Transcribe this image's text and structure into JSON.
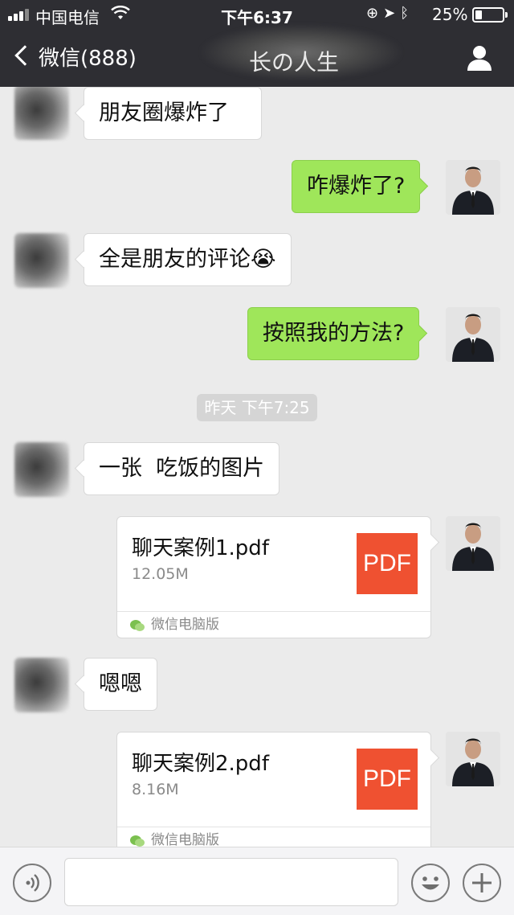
{
  "status_bar": {
    "carrier": "中国电信",
    "time": "下午6:37",
    "battery_percent": "25%",
    "battery_level": 0.25
  },
  "nav": {
    "back_label": "微信(888)",
    "title": "长の人生"
  },
  "messages": [
    {
      "side": "in",
      "text": "朋友圈爆炸了"
    },
    {
      "side": "out",
      "text": "咋爆炸了?"
    },
    {
      "side": "in",
      "text": "全是朋友的评论😭"
    },
    {
      "side": "out",
      "text": "按照我的方法?"
    },
    {
      "type": "timestamp",
      "text": "昨天 下午7:25"
    },
    {
      "side": "in",
      "text": "一张  吃饭的图片"
    },
    {
      "side": "out",
      "type": "file",
      "name": "聊天案例1.pdf",
      "size": "12.05M",
      "icon": "PDF",
      "source": "微信电脑版"
    },
    {
      "side": "in",
      "text": "嗯嗯"
    },
    {
      "side": "out",
      "type": "file",
      "name": "聊天案例2.pdf",
      "size": "8.16M",
      "icon": "PDF",
      "source": "微信电脑版"
    }
  ],
  "input_bar": {
    "voice_icon": "voice-icon",
    "emoji_icon": "emoji-icon",
    "plus_icon": "plus-icon"
  },
  "colors": {
    "header_bg": "#2e2e33",
    "chat_bg": "#ebebeb",
    "outgoing_bubble": "#9fe65a",
    "pdf_icon": "#ef5131"
  }
}
